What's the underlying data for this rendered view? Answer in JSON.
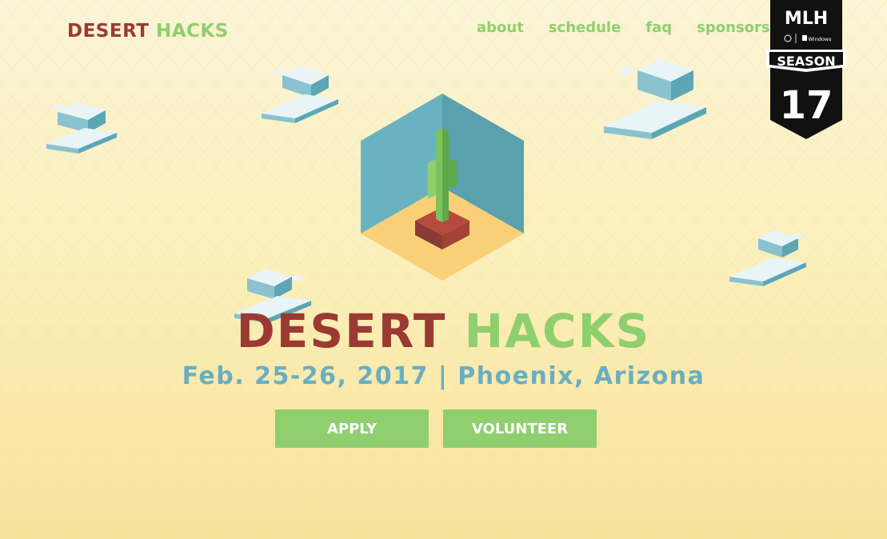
{
  "brand": {
    "word1": "DESERT",
    "word2": "HACKS"
  },
  "nav": {
    "items": [
      "about",
      "schedule",
      "faq",
      "sponsors"
    ]
  },
  "badge": {
    "top": "MLH",
    "season_label": "SEASON",
    "season_number": "17",
    "sponsor": "Windows"
  },
  "hero": {
    "word1": "DESERT",
    "word2": "HACKS",
    "subtitle": "Feb. 25-26, 2017 | Phoenix, Arizona",
    "apply_label": "APPLY",
    "volunteer_label": "VOLUNTEER"
  },
  "colors": {
    "brand_red": "#9b3a33",
    "brand_green": "#8fcf6e",
    "subtitle_blue": "#6aaec1",
    "background": "#fbeeb7"
  },
  "icons": [
    "cloud-icon",
    "cactus-cube-illustration",
    "mlh-season-badge"
  ]
}
